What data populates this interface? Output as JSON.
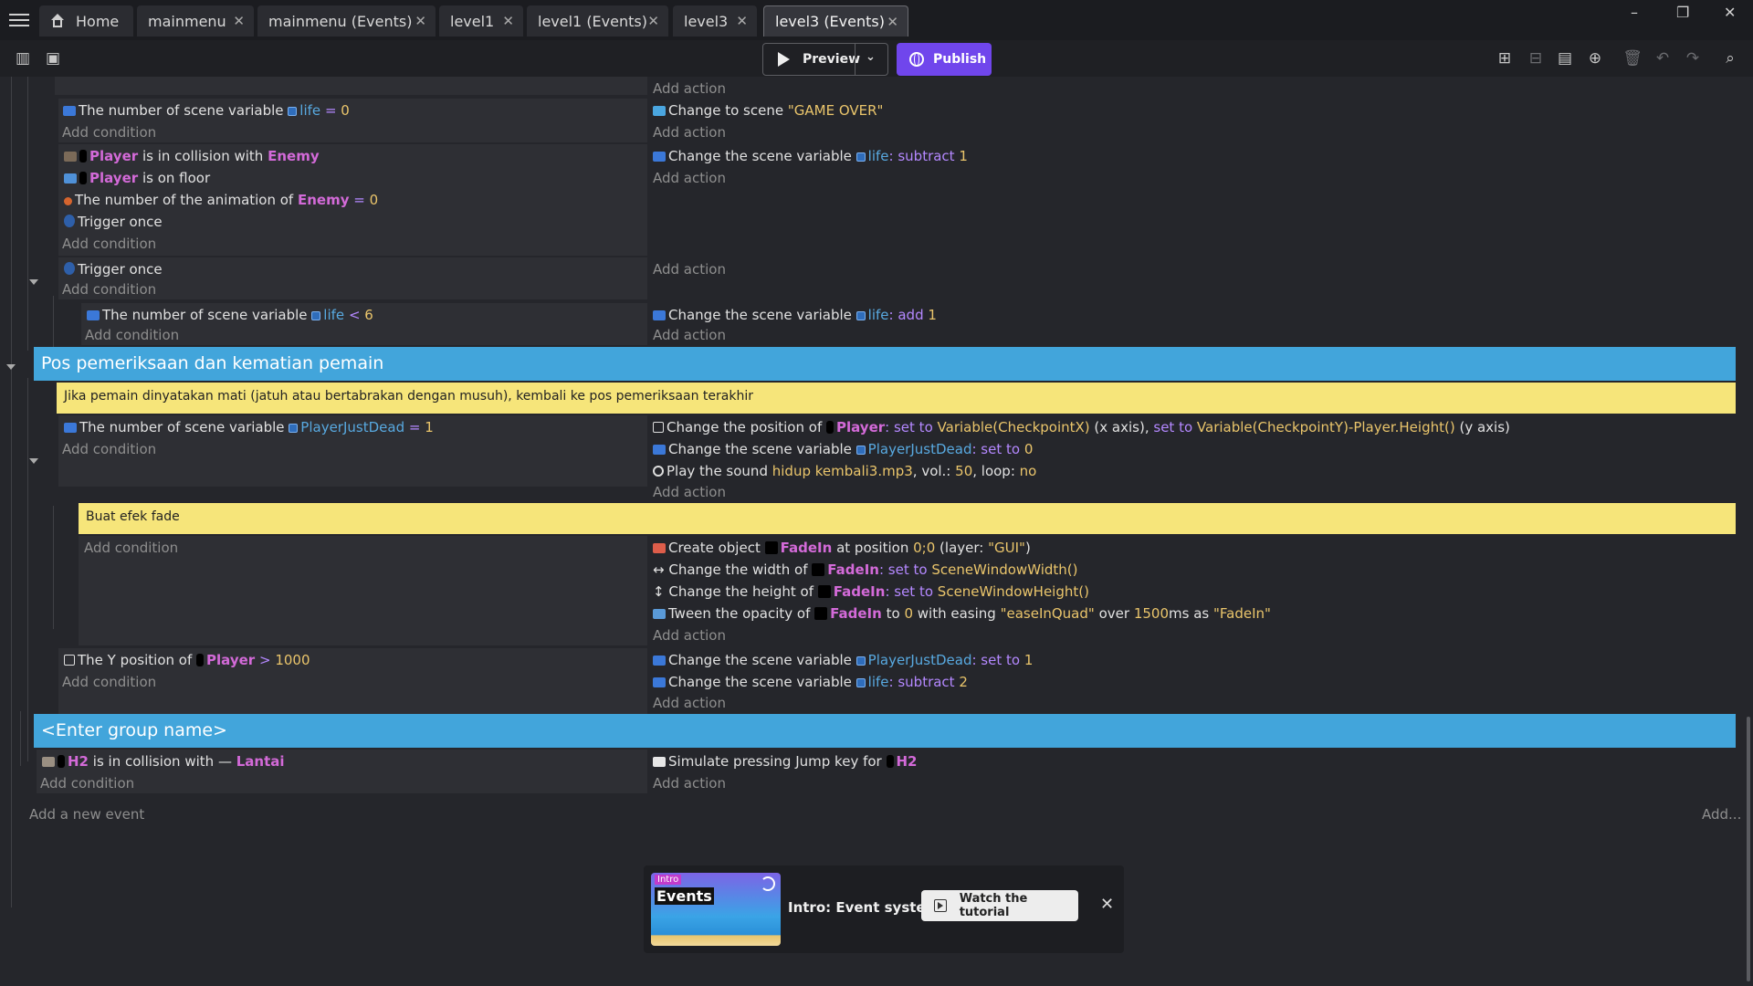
{
  "tabs": [
    {
      "label": "Home"
    },
    {
      "label": "mainmenu"
    },
    {
      "label": "mainmenu (Events)"
    },
    {
      "label": "level1"
    },
    {
      "label": "level1 (Events)"
    },
    {
      "label": "level3"
    },
    {
      "label": "level3 (Events)"
    }
  ],
  "toolbar": {
    "preview_label": "Preview",
    "publish_label": "Publish",
    "publish_color": "#7046ec"
  },
  "common": {
    "add_action": "Add action",
    "add_condition": "Add condition"
  },
  "events": {
    "e1": {
      "cond": {
        "t1": "The number of scene variable",
        "var": "life",
        "t2": "=",
        "v": "0"
      },
      "act": {
        "t1": "Change to scene",
        "v": "\"GAME OVER\""
      }
    },
    "e2": {
      "c1": {
        "obj": "Player",
        "t": "is in collision with",
        "obj2": "Enemy"
      },
      "c2": {
        "obj": "Player",
        "t": "is on floor"
      },
      "c3": {
        "t": "The number of the animation of",
        "obj": "Enemy",
        "op": "=",
        "v": "0"
      },
      "c4": {
        "t": "Trigger once"
      },
      "act": {
        "t1": "Change the scene variable",
        "var": "life",
        "op": ": subtract",
        "v": "1"
      }
    },
    "e3": {
      "c1": {
        "t": "Trigger once"
      }
    },
    "e4": {
      "cond": {
        "t1": "The number of scene variable",
        "var": "life",
        "op": "<",
        "v": "6"
      },
      "act": {
        "t1": "Change the scene variable",
        "var": "life",
        "op": ": add",
        "v": "1"
      }
    },
    "group1": {
      "title": "Pos pemeriksaan dan kematian pemain"
    },
    "comment1": {
      "text": "Jika pemain dinyatakan mati (jatuh atau bertabrakan dengan musuh), kembali ke pos pemeriksaan terakhir"
    },
    "e5": {
      "cond": {
        "t1": "The number of scene variable",
        "var": "PlayerJustDead",
        "op": "=",
        "v": "1"
      },
      "a1": {
        "t1": "Change the position of",
        "obj": "Player",
        "s1": ": set to",
        "v1": "Variable(CheckpointX)",
        "t2": "(x axis),",
        "s2": "set to",
        "v2": "Variable(CheckpointY)-Player.Height()",
        "t3": "(y axis)"
      },
      "a2": {
        "t1": "Change the scene variable",
        "var": "PlayerJustDead",
        "op": ": set to",
        "v": "0"
      },
      "a3": {
        "t1": "Play the sound",
        "v1": "hidup kembali3.mp3",
        "t2": ", vol.:",
        "v2": "50",
        "t3": ", loop:",
        "v3": "no"
      }
    },
    "comment2": {
      "text": "Buat efek fade"
    },
    "e6": {
      "a1": {
        "t1": "Create object",
        "obj": "FadeIn",
        "t2": "at position",
        "v1": "0;0",
        "t3": "(layer:",
        "v2": "\"GUI\"",
        "t4": ")"
      },
      "a2": {
        "t1": "Change the width of",
        "obj": "FadeIn",
        "op": ": set to",
        "v": "SceneWindowWidth()"
      },
      "a3": {
        "t1": "Change the height of",
        "obj": "FadeIn",
        "op": ": set to",
        "v": "SceneWindowHeight()"
      },
      "a4": {
        "t1": "Tween the opacity of",
        "obj": "FadeIn",
        "t2": "to",
        "v1": "0",
        "t3": "with easing",
        "v2": "\"easeInQuad\"",
        "t4": "over",
        "v3": "1500",
        "t5": "ms as",
        "v4": "\"FadeIn\""
      }
    },
    "e7": {
      "cond": {
        "t1": "The Y position of",
        "obj": "Player",
        "op": ">",
        "v": "1000"
      },
      "a1": {
        "t1": "Change the scene variable",
        "var": "PlayerJustDead",
        "op": ": set to",
        "v": "1"
      },
      "a2": {
        "t1": "Change the scene variable",
        "var": "life",
        "op": ": subtract",
        "v": "2"
      }
    },
    "group2": {
      "title": "<Enter group name>"
    },
    "e8": {
      "cond": {
        "obj": "H2",
        "t": "is in collision with",
        "obj2": "Lantai"
      },
      "act": {
        "t1": "Simulate pressing Jump key for",
        "obj": "H2"
      }
    }
  },
  "footer": {
    "add_event": "Add a new event",
    "add_more": "Add..."
  },
  "tutorial": {
    "tag": "Intro",
    "thumb_title": "Events",
    "title": "Intro: Event system",
    "button": "Watch the tutorial"
  }
}
